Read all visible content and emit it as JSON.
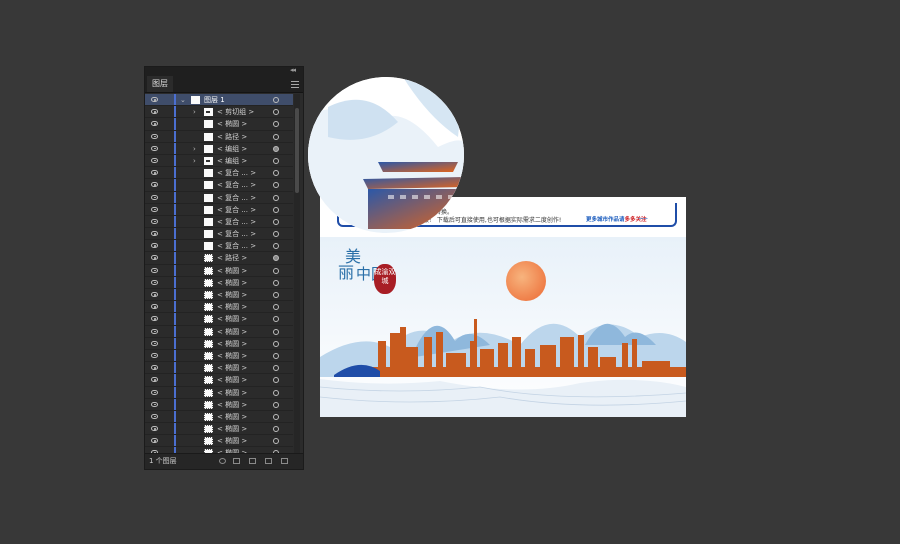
{
  "layers_panel": {
    "collapse_glyph": "◂◂",
    "tab_label": "图层",
    "footer_count": "1 个图层",
    "layers": [
      {
        "label": "图层 1",
        "top": true,
        "expand": "⌄",
        "thumb": "plain",
        "target": "open"
      },
      {
        "label": "< 剪切组 >",
        "expand": "›",
        "thumb": "mark",
        "target": "open"
      },
      {
        "label": "< 椭圆 >",
        "expand": "",
        "thumb": "plain",
        "target": "open"
      },
      {
        "label": "< 路径 >",
        "expand": "",
        "thumb": "plain",
        "target": "open"
      },
      {
        "label": "< 编组 >",
        "expand": "›",
        "thumb": "plain",
        "target": "fill"
      },
      {
        "label": "< 编组 >",
        "expand": "›",
        "thumb": "mark",
        "target": "open"
      },
      {
        "label": "< 复合 ... >",
        "expand": "",
        "thumb": "plain",
        "target": "open"
      },
      {
        "label": "< 复合 ... >",
        "expand": "",
        "thumb": "plain",
        "target": "open"
      },
      {
        "label": "< 复合 ... >",
        "expand": "",
        "thumb": "plain",
        "target": "open"
      },
      {
        "label": "< 复合 ... >",
        "expand": "",
        "thumb": "plain",
        "target": "open"
      },
      {
        "label": "< 复合 ... >",
        "expand": "",
        "thumb": "plain",
        "target": "open"
      },
      {
        "label": "< 复合 ... >",
        "expand": "",
        "thumb": "plain",
        "target": "open"
      },
      {
        "label": "< 复合 ... >",
        "expand": "",
        "thumb": "plain",
        "target": "open"
      },
      {
        "label": "< 路径 >",
        "expand": "",
        "thumb": "dash",
        "target": "fill"
      },
      {
        "label": "< 椭圆 >",
        "expand": "",
        "thumb": "dash",
        "target": "open"
      },
      {
        "label": "< 椭圆 >",
        "expand": "",
        "thumb": "dash",
        "target": "open"
      },
      {
        "label": "< 椭圆 >",
        "expand": "",
        "thumb": "dash",
        "target": "open"
      },
      {
        "label": "< 椭圆 >",
        "expand": "",
        "thumb": "dash",
        "target": "open"
      },
      {
        "label": "< 椭圆 >",
        "expand": "",
        "thumb": "dash",
        "target": "open"
      },
      {
        "label": "< 椭圆 >",
        "expand": "",
        "thumb": "dash",
        "target": "open"
      },
      {
        "label": "< 椭圆 >",
        "expand": "",
        "thumb": "dash",
        "target": "open"
      },
      {
        "label": "< 椭圆 >",
        "expand": "",
        "thumb": "dash",
        "target": "open"
      },
      {
        "label": "< 椭圆 >",
        "expand": "",
        "thumb": "dash",
        "target": "open"
      },
      {
        "label": "< 椭圆 >",
        "expand": "",
        "thumb": "dash",
        "target": "open"
      },
      {
        "label": "< 椭圆 >",
        "expand": "",
        "thumb": "dash",
        "target": "open"
      },
      {
        "label": "< 椭圆 >",
        "expand": "",
        "thumb": "dash",
        "target": "open"
      },
      {
        "label": "< 椭圆 >",
        "expand": "",
        "thumb": "dash",
        "target": "open"
      },
      {
        "label": "< 椭圆 >",
        "expand": "",
        "thumb": "dash",
        "target": "open"
      },
      {
        "label": "< 椭圆 >",
        "expand": "",
        "thumb": "dash",
        "target": "open"
      },
      {
        "label": "< 椭圆 >",
        "expand": "",
        "thumb": "dash",
        "target": "open"
      }
    ]
  },
  "artboard": {
    "line1": "格式转换。",
    "line2": "报！ 下载后可直接使用,也可根据实际需求二度创作!",
    "more_prefix": "更多城市作品请",
    "more_highlight": "多多关注",
    "more_dots": "..........",
    "title_mei": "美",
    "title_li": "丽",
    "title_zg": "中国",
    "seal_text": "成渝双城"
  },
  "colors": {
    "accent_blue": "#1f4da8",
    "city_orange": "#c85a1e",
    "sun": "#f08a52",
    "mountain": "#9ec4e3",
    "seal_red": "#a81e25"
  }
}
